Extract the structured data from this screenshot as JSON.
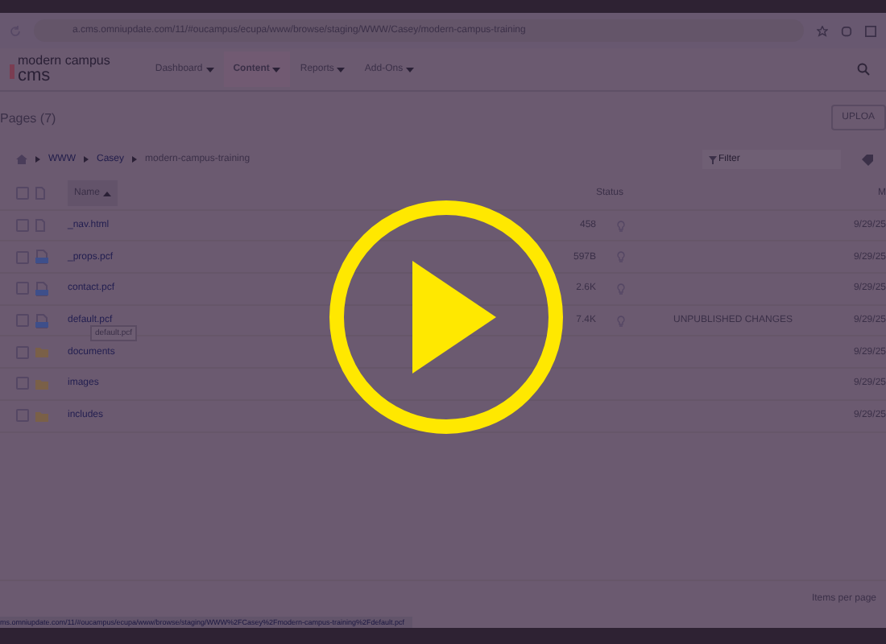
{
  "browser": {
    "url": "a.cms.omniupdate.com/11/#oucampus/ecupa/www/browse/staging/WWW/Casey/modern-campus-training"
  },
  "header": {
    "logo_line1": "modern campus",
    "logo_line2": "cms",
    "nav": [
      {
        "label": "Dashboard",
        "selected": false
      },
      {
        "label": "Content",
        "selected": true
      },
      {
        "label": "Reports",
        "selected": false
      },
      {
        "label": "Add-Ons",
        "selected": false
      }
    ]
  },
  "page": {
    "title": "Pages (7)",
    "upload_button": "UPLOA"
  },
  "breadcrumb": [
    "WWW",
    "Casey",
    "modern-campus-training"
  ],
  "filter": {
    "placeholder": "Filter"
  },
  "table": {
    "columns": [
      "Name",
      "Status",
      "M"
    ],
    "select_all_checked": false,
    "rows": [
      {
        "checked": false,
        "kind": "file",
        "name": "_nav.html",
        "size": "458",
        "modified": "9/29/25"
      },
      {
        "checked": false,
        "kind": "pcf",
        "name": "_props.pcf",
        "size": "597B",
        "modified": "9/29/25"
      },
      {
        "checked": false,
        "kind": "pcf",
        "name": "contact.pcf",
        "size": "2.6K",
        "modified": "9/29/25"
      },
      {
        "checked": false,
        "kind": "pcf",
        "name": "default.pcf",
        "size": "7.4K",
        "status": "UNPUBLISHED CHANGES",
        "modified": "9/29/25"
      },
      {
        "checked": false,
        "kind": "folder",
        "name": "documents",
        "modified": "9/29/25"
      },
      {
        "checked": false,
        "kind": "folder",
        "name": "images",
        "modified": "9/29/25"
      },
      {
        "checked": false,
        "kind": "folder",
        "name": "includes",
        "modified": "9/29/25"
      }
    ]
  },
  "tooltip": "default.pcf",
  "footer": {
    "items_per_page": "Items per page"
  },
  "status_bar": {
    "link": "ms.omniupdate.com/11/#oucampus/ecupa/www/browse/staging/WWW%2FCasey%2Fmodern-campus-training%2Fdefault.pcf"
  }
}
